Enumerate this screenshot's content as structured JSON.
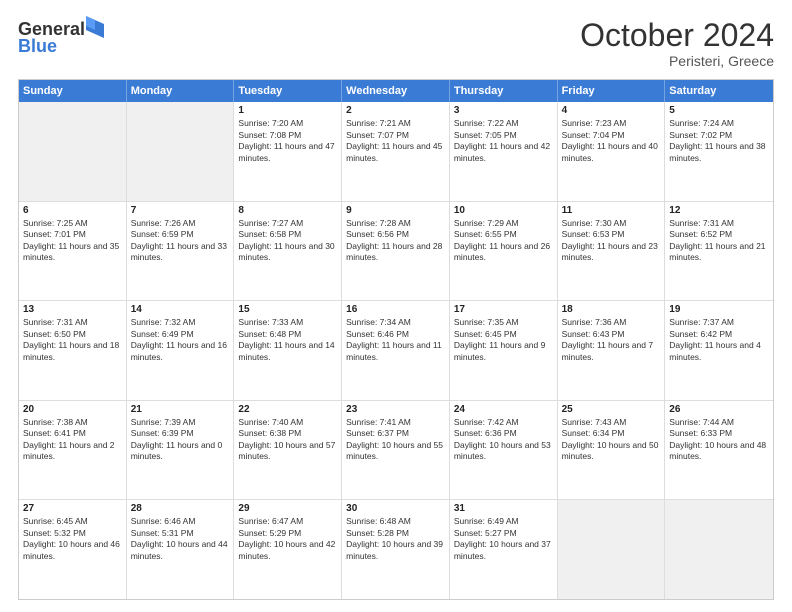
{
  "header": {
    "logo_general": "General",
    "logo_blue": "Blue",
    "month_title": "October 2024",
    "location": "Peristeri, Greece"
  },
  "days_of_week": [
    "Sunday",
    "Monday",
    "Tuesday",
    "Wednesday",
    "Thursday",
    "Friday",
    "Saturday"
  ],
  "weeks": [
    [
      {
        "day": "",
        "sunrise": "",
        "sunset": "",
        "daylight": ""
      },
      {
        "day": "",
        "sunrise": "",
        "sunset": "",
        "daylight": ""
      },
      {
        "day": "1",
        "sunrise": "Sunrise: 7:20 AM",
        "sunset": "Sunset: 7:08 PM",
        "daylight": "Daylight: 11 hours and 47 minutes."
      },
      {
        "day": "2",
        "sunrise": "Sunrise: 7:21 AM",
        "sunset": "Sunset: 7:07 PM",
        "daylight": "Daylight: 11 hours and 45 minutes."
      },
      {
        "day": "3",
        "sunrise": "Sunrise: 7:22 AM",
        "sunset": "Sunset: 7:05 PM",
        "daylight": "Daylight: 11 hours and 42 minutes."
      },
      {
        "day": "4",
        "sunrise": "Sunrise: 7:23 AM",
        "sunset": "Sunset: 7:04 PM",
        "daylight": "Daylight: 11 hours and 40 minutes."
      },
      {
        "day": "5",
        "sunrise": "Sunrise: 7:24 AM",
        "sunset": "Sunset: 7:02 PM",
        "daylight": "Daylight: 11 hours and 38 minutes."
      }
    ],
    [
      {
        "day": "6",
        "sunrise": "Sunrise: 7:25 AM",
        "sunset": "Sunset: 7:01 PM",
        "daylight": "Daylight: 11 hours and 35 minutes."
      },
      {
        "day": "7",
        "sunrise": "Sunrise: 7:26 AM",
        "sunset": "Sunset: 6:59 PM",
        "daylight": "Daylight: 11 hours and 33 minutes."
      },
      {
        "day": "8",
        "sunrise": "Sunrise: 7:27 AM",
        "sunset": "Sunset: 6:58 PM",
        "daylight": "Daylight: 11 hours and 30 minutes."
      },
      {
        "day": "9",
        "sunrise": "Sunrise: 7:28 AM",
        "sunset": "Sunset: 6:56 PM",
        "daylight": "Daylight: 11 hours and 28 minutes."
      },
      {
        "day": "10",
        "sunrise": "Sunrise: 7:29 AM",
        "sunset": "Sunset: 6:55 PM",
        "daylight": "Daylight: 11 hours and 26 minutes."
      },
      {
        "day": "11",
        "sunrise": "Sunrise: 7:30 AM",
        "sunset": "Sunset: 6:53 PM",
        "daylight": "Daylight: 11 hours and 23 minutes."
      },
      {
        "day": "12",
        "sunrise": "Sunrise: 7:31 AM",
        "sunset": "Sunset: 6:52 PM",
        "daylight": "Daylight: 11 hours and 21 minutes."
      }
    ],
    [
      {
        "day": "13",
        "sunrise": "Sunrise: 7:31 AM",
        "sunset": "Sunset: 6:50 PM",
        "daylight": "Daylight: 11 hours and 18 minutes."
      },
      {
        "day": "14",
        "sunrise": "Sunrise: 7:32 AM",
        "sunset": "Sunset: 6:49 PM",
        "daylight": "Daylight: 11 hours and 16 minutes."
      },
      {
        "day": "15",
        "sunrise": "Sunrise: 7:33 AM",
        "sunset": "Sunset: 6:48 PM",
        "daylight": "Daylight: 11 hours and 14 minutes."
      },
      {
        "day": "16",
        "sunrise": "Sunrise: 7:34 AM",
        "sunset": "Sunset: 6:46 PM",
        "daylight": "Daylight: 11 hours and 11 minutes."
      },
      {
        "day": "17",
        "sunrise": "Sunrise: 7:35 AM",
        "sunset": "Sunset: 6:45 PM",
        "daylight": "Daylight: 11 hours and 9 minutes."
      },
      {
        "day": "18",
        "sunrise": "Sunrise: 7:36 AM",
        "sunset": "Sunset: 6:43 PM",
        "daylight": "Daylight: 11 hours and 7 minutes."
      },
      {
        "day": "19",
        "sunrise": "Sunrise: 7:37 AM",
        "sunset": "Sunset: 6:42 PM",
        "daylight": "Daylight: 11 hours and 4 minutes."
      }
    ],
    [
      {
        "day": "20",
        "sunrise": "Sunrise: 7:38 AM",
        "sunset": "Sunset: 6:41 PM",
        "daylight": "Daylight: 11 hours and 2 minutes."
      },
      {
        "day": "21",
        "sunrise": "Sunrise: 7:39 AM",
        "sunset": "Sunset: 6:39 PM",
        "daylight": "Daylight: 11 hours and 0 minutes."
      },
      {
        "day": "22",
        "sunrise": "Sunrise: 7:40 AM",
        "sunset": "Sunset: 6:38 PM",
        "daylight": "Daylight: 10 hours and 57 minutes."
      },
      {
        "day": "23",
        "sunrise": "Sunrise: 7:41 AM",
        "sunset": "Sunset: 6:37 PM",
        "daylight": "Daylight: 10 hours and 55 minutes."
      },
      {
        "day": "24",
        "sunrise": "Sunrise: 7:42 AM",
        "sunset": "Sunset: 6:36 PM",
        "daylight": "Daylight: 10 hours and 53 minutes."
      },
      {
        "day": "25",
        "sunrise": "Sunrise: 7:43 AM",
        "sunset": "Sunset: 6:34 PM",
        "daylight": "Daylight: 10 hours and 50 minutes."
      },
      {
        "day": "26",
        "sunrise": "Sunrise: 7:44 AM",
        "sunset": "Sunset: 6:33 PM",
        "daylight": "Daylight: 10 hours and 48 minutes."
      }
    ],
    [
      {
        "day": "27",
        "sunrise": "Sunrise: 6:45 AM",
        "sunset": "Sunset: 5:32 PM",
        "daylight": "Daylight: 10 hours and 46 minutes."
      },
      {
        "day": "28",
        "sunrise": "Sunrise: 6:46 AM",
        "sunset": "Sunset: 5:31 PM",
        "daylight": "Daylight: 10 hours and 44 minutes."
      },
      {
        "day": "29",
        "sunrise": "Sunrise: 6:47 AM",
        "sunset": "Sunset: 5:29 PM",
        "daylight": "Daylight: 10 hours and 42 minutes."
      },
      {
        "day": "30",
        "sunrise": "Sunrise: 6:48 AM",
        "sunset": "Sunset: 5:28 PM",
        "daylight": "Daylight: 10 hours and 39 minutes."
      },
      {
        "day": "31",
        "sunrise": "Sunrise: 6:49 AM",
        "sunset": "Sunset: 5:27 PM",
        "daylight": "Daylight: 10 hours and 37 minutes."
      },
      {
        "day": "",
        "sunrise": "",
        "sunset": "",
        "daylight": ""
      },
      {
        "day": "",
        "sunrise": "",
        "sunset": "",
        "daylight": ""
      }
    ]
  ]
}
